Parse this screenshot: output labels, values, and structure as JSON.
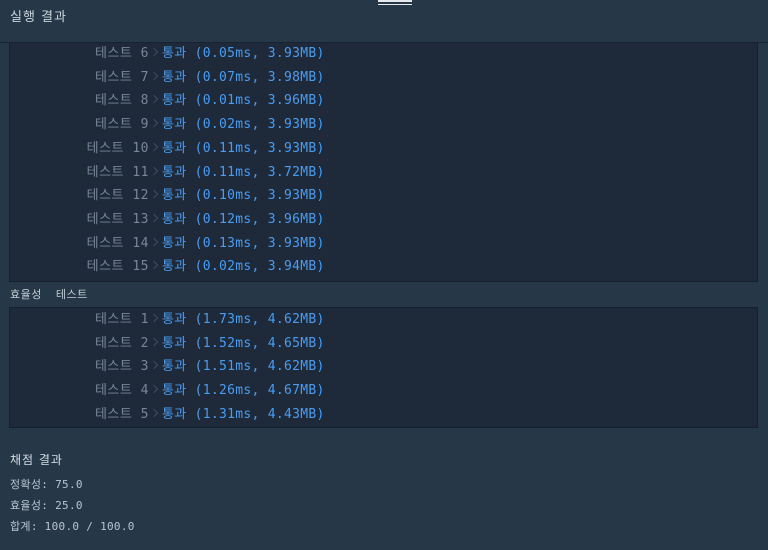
{
  "header": {
    "title": "실행 결과"
  },
  "accuracy_tests": [
    {
      "label": "테스트 6",
      "result": "통과 (0.05ms, 3.93MB)"
    },
    {
      "label": "테스트 7",
      "result": "통과 (0.07ms, 3.98MB)"
    },
    {
      "label": "테스트 8",
      "result": "통과 (0.01ms, 3.96MB)"
    },
    {
      "label": "테스트 9",
      "result": "통과 (0.02ms, 3.93MB)"
    },
    {
      "label": "테스트 10",
      "result": "통과 (0.11ms, 3.93MB)"
    },
    {
      "label": "테스트 11",
      "result": "통과 (0.11ms, 3.72MB)"
    },
    {
      "label": "테스트 12",
      "result": "통과 (0.10ms, 3.93MB)"
    },
    {
      "label": "테스트 13",
      "result": "통과 (0.12ms, 3.96MB)"
    },
    {
      "label": "테스트 14",
      "result": "통과 (0.13ms, 3.93MB)"
    },
    {
      "label": "테스트 15",
      "result": "통과 (0.02ms, 3.94MB)"
    }
  ],
  "efficiency_section": {
    "label_part1": "효율성",
    "label_part2": "테스트"
  },
  "efficiency_tests": [
    {
      "label": "테스트 1",
      "result": "통과 (1.73ms, 4.62MB)"
    },
    {
      "label": "테스트 2",
      "result": "통과 (1.52ms, 4.65MB)"
    },
    {
      "label": "테스트 3",
      "result": "통과 (1.51ms, 4.62MB)"
    },
    {
      "label": "테스트 4",
      "result": "통과 (1.26ms, 4.67MB)"
    },
    {
      "label": "테스트 5",
      "result": "통과 (1.31ms, 4.43MB)"
    }
  ],
  "score": {
    "title": "채점 결과",
    "accuracy": "정확성: 75.0",
    "efficiency": "효율성: 25.0",
    "total": "합계: 100.0 / 100.0"
  },
  "colors": {
    "background": "#263747",
    "panel": "#1e2a3a",
    "pass": "#4a9cf0",
    "label": "#78869a"
  }
}
